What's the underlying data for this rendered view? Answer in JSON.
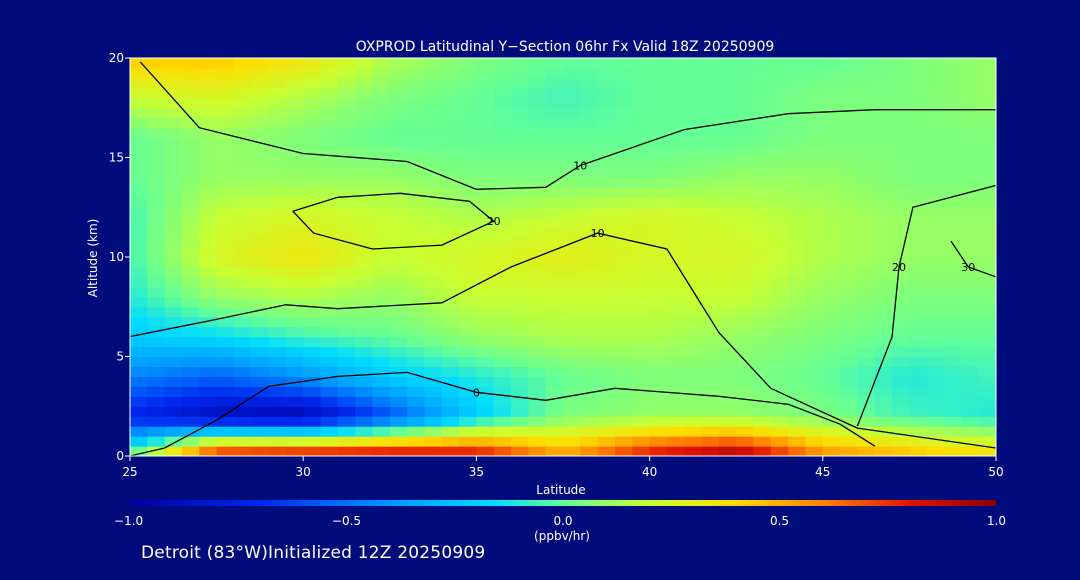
{
  "chart_data": {
    "type": "heatmap",
    "title": "OXPROD Latitudinal Y−Section 06hr  Fx Valid 18Z 20250909",
    "xlabel": "Latitude",
    "ylabel": "Altitude (km)",
    "xlim": [
      25,
      50
    ],
    "ylim": [
      0,
      20
    ],
    "xticks": [
      "25",
      "30",
      "35",
      "40",
      "45",
      "50"
    ],
    "yticks": [
      "0",
      "5",
      "10",
      "15",
      "20"
    ],
    "colorbar": {
      "label": "(ppbv/hr)",
      "range": [
        -1.0,
        1.0
      ],
      "ticks": [
        "−1.0",
        "−0.5",
        "0.0",
        "0.5",
        "1.0"
      ]
    },
    "field": {
      "x": [
        25,
        27.5,
        30,
        32.5,
        35,
        37.5,
        40,
        42.5,
        45,
        47.5,
        50
      ],
      "y": [
        0,
        2,
        4,
        6,
        8,
        10,
        12,
        14,
        16,
        18,
        20
      ],
      "z": [
        [
          0.05,
          0.9,
          0.95,
          0.95,
          0.9,
          0.55,
          0.85,
          1.0,
          0.6,
          0.5,
          0.4
        ],
        [
          -0.75,
          -0.9,
          -0.95,
          -0.6,
          -0.2,
          0.05,
          0.1,
          0.1,
          0.05,
          -0.05,
          -0.1
        ],
        [
          -0.45,
          -0.55,
          -0.4,
          -0.2,
          -0.1,
          0.0,
          0.05,
          0.05,
          0.0,
          -0.1,
          -0.05
        ],
        [
          -0.2,
          -0.15,
          -0.05,
          0.0,
          0.1,
          0.15,
          0.15,
          0.1,
          0.05,
          0.0,
          0.0
        ],
        [
          -0.1,
          0.1,
          0.15,
          0.1,
          0.2,
          0.2,
          0.2,
          0.2,
          0.1,
          0.05,
          0.05
        ],
        [
          -0.05,
          0.25,
          0.35,
          0.2,
          0.25,
          0.3,
          0.25,
          0.25,
          0.15,
          0.1,
          0.1
        ],
        [
          -0.05,
          0.2,
          0.25,
          0.2,
          0.15,
          0.2,
          0.25,
          0.2,
          0.15,
          0.1,
          0.1
        ],
        [
          0.0,
          0.1,
          0.1,
          0.1,
          0.05,
          0.05,
          0.05,
          0.1,
          0.1,
          0.05,
          0.05
        ],
        [
          0.0,
          0.1,
          0.05,
          0.0,
          0.0,
          0.0,
          0.0,
          0.0,
          0.05,
          0.05,
          0.05
        ],
        [
          0.2,
          0.25,
          0.15,
          0.05,
          0.0,
          -0.05,
          0.0,
          0.0,
          0.05,
          0.05,
          0.1
        ],
        [
          0.45,
          0.45,
          0.35,
          0.15,
          0.05,
          0.0,
          0.0,
          0.0,
          0.0,
          0.05,
          0.1
        ]
      ]
    },
    "contours": [
      {
        "level": "0",
        "points": [
          [
            25,
            0
          ],
          [
            26,
            0.4
          ],
          [
            27.5,
            1.8
          ],
          [
            29,
            3.5
          ],
          [
            31,
            4
          ],
          [
            33,
            4.2
          ],
          [
            35,
            3.2
          ],
          [
            37,
            2.8
          ],
          [
            39,
            3.4
          ],
          [
            42,
            3
          ],
          [
            44,
            2.6
          ],
          [
            45.5,
            1.6
          ],
          [
            46.5,
            0.5
          ]
        ]
      },
      {
        "level": "10",
        "points": [
          [
            25.3,
            19.8
          ],
          [
            27,
            16.5
          ],
          [
            30,
            15.2
          ],
          [
            33,
            14.8
          ],
          [
            35,
            13.4
          ],
          [
            37,
            13.5
          ],
          [
            38,
            14.6
          ],
          [
            41,
            16.4
          ],
          [
            44,
            17.2
          ],
          [
            46.5,
            17.4
          ],
          [
            48.5,
            17.4
          ],
          [
            50,
            17.4
          ]
        ]
      },
      {
        "level": "10",
        "points": [
          [
            25,
            6
          ],
          [
            27.3,
            6.8
          ],
          [
            29.5,
            7.6
          ],
          [
            31,
            7.4
          ],
          [
            34,
            7.7
          ],
          [
            36,
            9.5
          ],
          [
            38.5,
            11.2
          ],
          [
            40.5,
            10.4
          ],
          [
            42,
            6.2
          ],
          [
            43.5,
            3.4
          ],
          [
            46,
            1.4
          ],
          [
            50,
            0.4
          ]
        ]
      },
      {
        "level": "20",
        "points": [
          [
            29.7,
            12.3
          ],
          [
            30.3,
            11.2
          ],
          [
            32,
            10.4
          ],
          [
            34,
            10.6
          ],
          [
            35.5,
            11.8
          ],
          [
            34.8,
            12.8
          ],
          [
            32.8,
            13.2
          ],
          [
            31,
            13.0
          ],
          [
            29.7,
            12.3
          ]
        ]
      },
      {
        "level": "20",
        "points": [
          [
            46,
            1.5
          ],
          [
            47,
            6
          ],
          [
            47.2,
            9.5
          ],
          [
            47.6,
            12.5
          ],
          [
            50,
            13.6
          ]
        ]
      },
      {
        "level": "30",
        "points": [
          [
            48.7,
            10.8
          ],
          [
            49.2,
            9.5
          ],
          [
            50,
            9.0
          ]
        ]
      }
    ]
  },
  "footer": "Detroit (83°W)Initialized 12Z 20250909"
}
